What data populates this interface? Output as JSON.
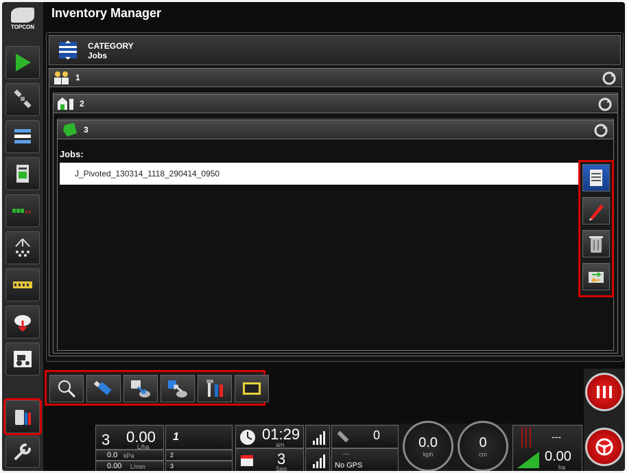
{
  "app": {
    "title": "Inventory Manager",
    "logo_text": "TOPCON"
  },
  "category": {
    "label": "CATEGORY",
    "value": "Jobs"
  },
  "levels": [
    {
      "label": "1"
    },
    {
      "label": "2"
    },
    {
      "label": "3"
    }
  ],
  "jobs": {
    "label": "Jobs:",
    "items": [
      "J_Pivoted_130314_1118_290414_0950"
    ]
  },
  "sidebar": {
    "items": [
      {
        "icon": "play-icon"
      },
      {
        "icon": "satellite-icon"
      },
      {
        "icon": "layers-icon"
      },
      {
        "icon": "console-icon"
      },
      {
        "icon": "section-bar-icon"
      },
      {
        "icon": "sprayer-icon"
      },
      {
        "icon": "boom-icon"
      },
      {
        "icon": "cloud-transfer-icon"
      },
      {
        "icon": "tractor-icon"
      },
      {
        "icon": "inventory-icon"
      },
      {
        "icon": "wrench-icon"
      }
    ]
  },
  "status": {
    "rate_index": "3",
    "rate_value": "0.00",
    "rate_unit": "L/ha",
    "pressure_value": "0.0",
    "pressure_unit": "kPa",
    "flow_value": "0.00",
    "flow_unit": "L/min",
    "count_1": "1",
    "count_2": "2",
    "count_3": "3",
    "time": "01:29",
    "time_ampm": "am",
    "date_day": "3",
    "date_month": "Sep",
    "gps_count": "0",
    "gps_dash": "---",
    "gps_status": "No GPS",
    "speed_value": "0.0",
    "speed_unit": "kph",
    "offset_value": "0",
    "offset_unit": "cm",
    "area_dash": "---",
    "area_value": "0.00",
    "area_unit": "ha"
  },
  "colors": {
    "highlight": "#d60000",
    "background": "#0d0d0d",
    "accent_green": "#2db52d"
  }
}
